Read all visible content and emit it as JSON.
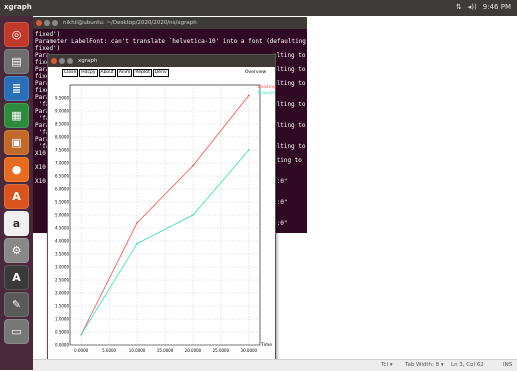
{
  "topbar": {
    "title": "xgraph",
    "tray": [
      "⇅",
      "◂))",
      "9:46 PM"
    ]
  },
  "launcher": {
    "items": [
      {
        "name": "dash-icon",
        "glyph": "◎",
        "color": "#c0392b"
      },
      {
        "name": "files-icon",
        "glyph": "▤",
        "color": "#6d6d6d"
      },
      {
        "name": "writer-icon",
        "glyph": "≣",
        "color": "#2a6fb5"
      },
      {
        "name": "calc-icon",
        "glyph": "▦",
        "color": "#2e8b3d"
      },
      {
        "name": "impress-icon",
        "glyph": "▣",
        "color": "#c2692a"
      },
      {
        "name": "firefox-icon",
        "glyph": "●",
        "color": "#e66b1f"
      },
      {
        "name": "software-center-icon",
        "glyph": "A",
        "color": "#d9541e"
      },
      {
        "name": "amazon-icon",
        "glyph": "a",
        "color": "#f0f0f0"
      },
      {
        "name": "settings-icon",
        "glyph": "⚙",
        "color": "#888888"
      },
      {
        "name": "updater-icon",
        "glyph": "A",
        "color": "#3a3a3a"
      },
      {
        "name": "editor-icon",
        "glyph": "✎",
        "color": "#5a5a5a"
      },
      {
        "name": "printer-icon",
        "glyph": "▭",
        "color": "#777777"
      }
    ]
  },
  "terminal": {
    "title": "nikhil@ubuntu: ~/Desktop/2020/2020/ns/xgraph",
    "lines": [
      "fixed')",
      "Parameter LabelFont: can't translate `helvetica-10' into a font (defaulting to",
      "fixed')",
      "Para",
      "fixe",
      "Para",
      "fixe",
      "Para",
      "fixe",
      "Para",
      " 'fa",
      "Para",
      " 'fa",
      "Para",
      " 'fa",
      "Para",
      " 'fa",
      "X10",
      "",
      "X10",
      "",
      "X10"
    ],
    "right_fragments": [
      {
        "line": 3,
        "text": "ulting to"
      },
      {
        "line": 5,
        "text": "ulting to"
      },
      {
        "line": 7,
        "text": "ulting to"
      },
      {
        "line": 10,
        "text": "ulting to"
      },
      {
        "line": 13,
        "text": "ulting to"
      },
      {
        "line": 16,
        "text": "ulting to"
      },
      {
        "line": 18,
        "text": "lting to"
      },
      {
        "line": 21,
        "text": "\":0\""
      },
      {
        "line": 24,
        "text": "\":0\""
      },
      {
        "line": 27,
        "text": "\":0\""
      }
    ]
  },
  "xgraph": {
    "title": "xgraph",
    "buttons": [
      "Close",
      "Hdcpy",
      "About",
      "Anim",
      "Replot",
      "Deriv"
    ],
    "overview": "Overview"
  },
  "colors": {
    "existing": "#ff4b4b",
    "proposed": "#2ee6b4"
  },
  "chart_data": {
    "type": "line",
    "x_ticks": [
      "0.0000",
      "5.0000",
      "10.0000",
      "15.0000",
      "20.0000",
      "25.0000",
      "30.0000"
    ],
    "y_ticks": [
      "0.0000",
      "0.5000",
      "1.0000",
      "1.5000",
      "2.0000",
      "2.5000",
      "3.0000",
      "3.5000",
      "4.0000",
      "4.5000",
      "5.0000",
      "5.5000",
      "6.0000",
      "6.5000",
      "7.0000",
      "7.5000",
      "8.0000",
      "8.5000",
      "9.0000",
      "9.5000"
    ],
    "xlim": [
      -2,
      32
    ],
    "ylim": [
      0,
      10
    ],
    "xlabel": "Time",
    "series": [
      {
        "name": "Existing",
        "x": [
          0,
          10,
          20,
          30
        ],
        "y": [
          0.4,
          4.7,
          6.9,
          9.6
        ]
      },
      {
        "name": "Proposed",
        "x": [
          0,
          10,
          20,
          30
        ],
        "y": [
          0.4,
          3.9,
          5.0,
          7.5
        ]
      }
    ],
    "grid": true,
    "legend": "top-right"
  }
}
